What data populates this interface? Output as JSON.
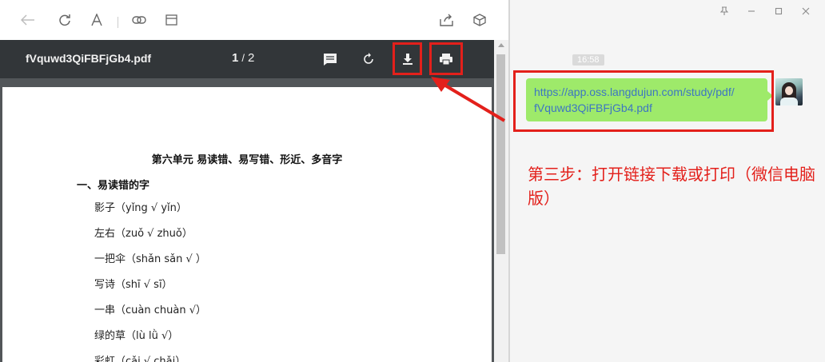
{
  "browser": {
    "toolbar_icons": [
      "back-arrow-icon",
      "refresh-icon",
      "font-icon",
      "link-icon",
      "window-icon",
      "share-icon",
      "cube-icon"
    ]
  },
  "pdf_viewer": {
    "file_name": "fVquwd3QiFBFjGb4.pdf",
    "current_page": "1",
    "page_separator": "/",
    "total_pages": "2",
    "buttons": [
      "comment-icon",
      "rotate-icon",
      "download-icon",
      "print-icon"
    ]
  },
  "document": {
    "heading": "第六单元  易读错、易写错、形近、多音字",
    "section_title": "一、易读错的字",
    "items": [
      "影子（yǐng √ yǐn）",
      "左右（zuǒ √ zhuǒ）",
      "一把伞（shǎn sǎn √ ）",
      "写诗（shī √ sī）",
      "一串（cuàn chuàn √）",
      "绿的草（lù lǜ √）",
      "彩虹（cǎi √ chǎi）"
    ]
  },
  "chat": {
    "timestamp": "16:58",
    "link_line1": "https://app.oss.langdujun.com/study/pdf/",
    "link_line2": "fVquwd3QiFBFjGb4.pdf",
    "annotation": "第三步：打开链接下载或打印（微信电脑版）"
  },
  "colors": {
    "highlight": "#e3201b",
    "bubble": "#9eea6a",
    "link": "#3d76c2",
    "pdf_bar": "#323639"
  }
}
